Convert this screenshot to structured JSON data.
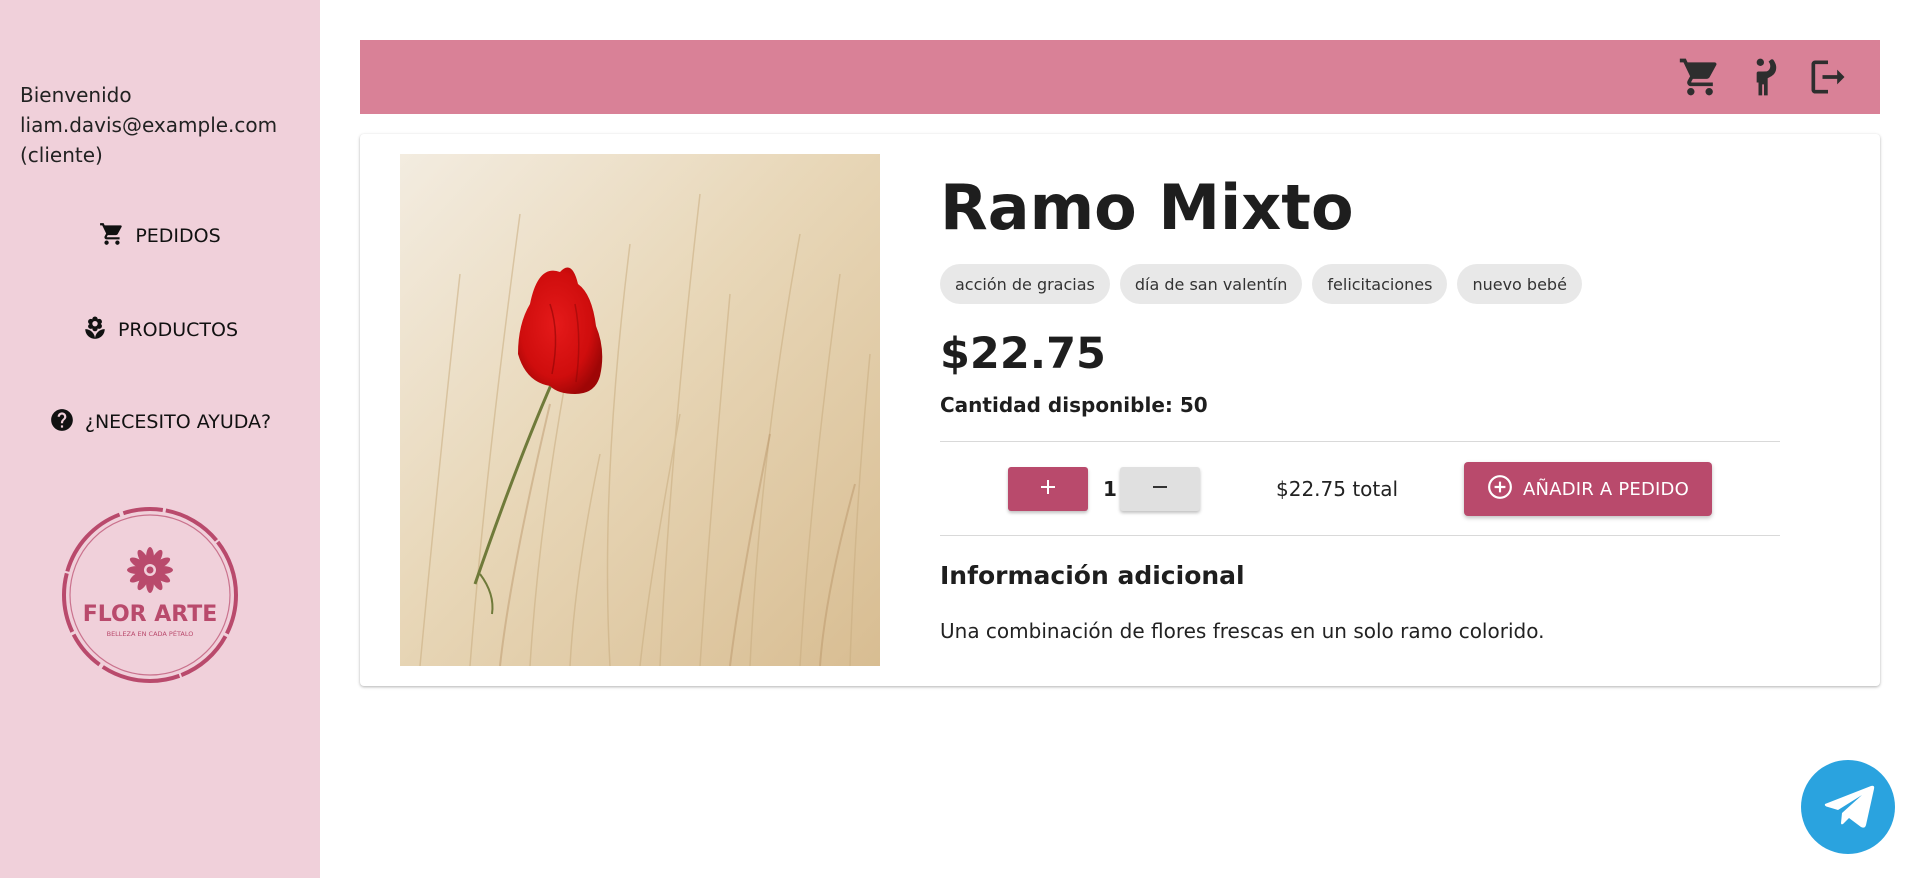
{
  "sidebar": {
    "welcome_greeting": "Bienvenido",
    "user_email": "liam.davis@example.com",
    "user_role": "(cliente)",
    "nav": {
      "orders_label": "PEDIDOS",
      "products_label": "PRODUCTOS",
      "help_label": "¿NECESITO AYUDA?"
    },
    "logo": {
      "brand": "FLOR ARTE",
      "tagline": "BELLEZA EN CADA PÉTALO"
    }
  },
  "header": {
    "icons": [
      "shopping-cart-icon",
      "person-waving-icon",
      "logout-icon"
    ],
    "background_color": "#d98197"
  },
  "product": {
    "name": "Ramo Mixto",
    "tags": [
      "acción de gracias",
      "día de san valentín",
      "felicitaciones",
      "nuevo bebé"
    ],
    "price": "$22.75",
    "stock_text": "Cantidad disponible: 50",
    "quantity": "1",
    "total_text": "$22.75 total",
    "add_button_label": "AÑADIR A PEDIDO",
    "additional_info_title": "Información adicional",
    "description": "Una combinación de flores frescas en un solo ramo colorido."
  },
  "colors": {
    "sidebar_bg": "#f0d0da",
    "accent": "#b94a6c",
    "telegram": "#2aa3df"
  }
}
